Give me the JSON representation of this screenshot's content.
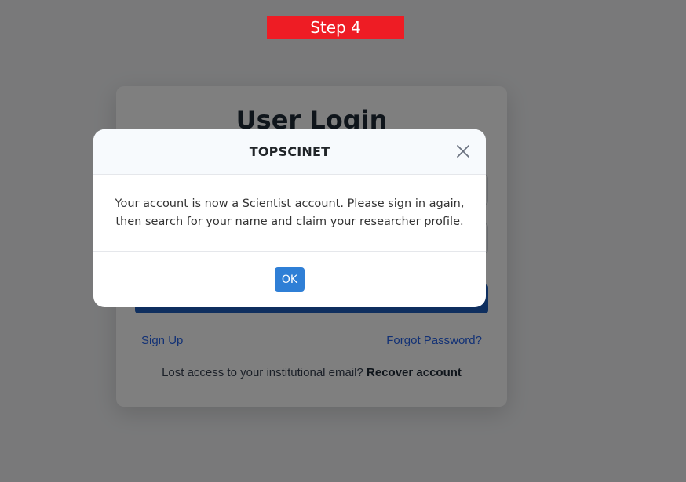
{
  "step_banner": {
    "label": "Step 4",
    "color": "#ee1c24"
  },
  "login": {
    "title": "User Login",
    "signup_link": "Sign Up",
    "forgot_link": "Forgot Password?",
    "recover_prompt": "Lost access to your institutional email?",
    "recover_link": "Recover account",
    "submit_color": "#1e5fbf"
  },
  "modal": {
    "title": "TOPSCINET",
    "close_icon": "close-icon",
    "message": "Your account is now a Scientist account. Please sign in again, then search for your name and claim your researcher profile.",
    "ok_label": "OK",
    "ok_color": "#2f7fd6"
  }
}
